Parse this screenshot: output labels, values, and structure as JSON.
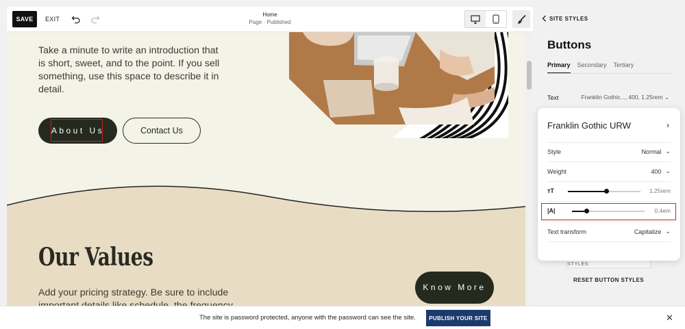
{
  "toolbar": {
    "save_label": "SAVE",
    "exit_label": "EXIT",
    "page_name": "Home",
    "page_status": "Page · Published",
    "icons": [
      "undo-icon",
      "redo-icon",
      "desktop-icon",
      "mobile-icon",
      "paintbrush-icon"
    ]
  },
  "canvas": {
    "intro_text": "Take a minute to write an introduction that is short, sweet, and to the point. If you sell something, use this space to describe it in detail.",
    "about_button": "About Us",
    "contact_button": "Contact Us",
    "values_title": "Our Values",
    "values_text": "Add your pricing strategy. Be sure to include important details like schedule, the frequency",
    "know_button": "Know More"
  },
  "panel": {
    "back_label": "SITE STYLES",
    "title": "Buttons",
    "tabs": [
      {
        "label": "Primary",
        "active": true
      },
      {
        "label": "Secondary",
        "active": false
      },
      {
        "label": "Tertiary",
        "active": false
      }
    ],
    "text_row": {
      "label": "Text",
      "value": "Franklin Gothic..., 400, 1.25rem"
    },
    "apply_label": "APPLY TO ALL BUTTON STYLES",
    "reset_label": "RESET BUTTON STYLES"
  },
  "popover": {
    "font_name": "Franklin Gothic URW",
    "style": {
      "label": "Style",
      "value": "Normal"
    },
    "weight": {
      "label": "Weight",
      "value": "400"
    },
    "font_size": {
      "value": "1.25rem",
      "level": 0.53
    },
    "letter_spacing": {
      "value": "0.4em",
      "level": 0.2
    },
    "text_transform": {
      "label": "Text transform",
      "value": "Capitalize"
    }
  },
  "banner": {
    "message": "The site is password protected, anyone with the password can see the site.",
    "publish_label": "PUBLISH YOUR SITE"
  },
  "colors": {
    "accent_dark": "#252a1f",
    "canvas_bg": "#f4f3e8",
    "values_bg": "#e8dcc4",
    "publish_blue": "#1c3a6e",
    "highlight_red": "#d61f1f"
  }
}
